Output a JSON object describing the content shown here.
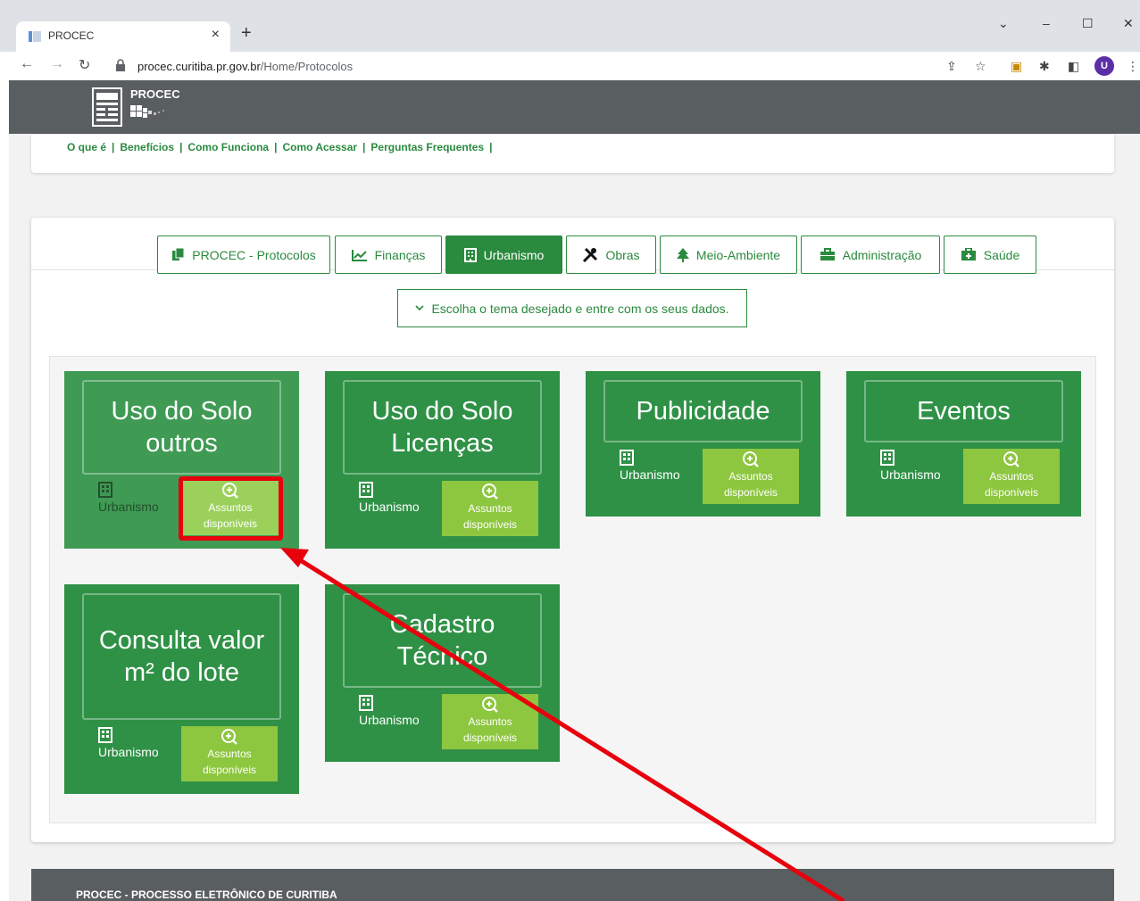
{
  "browser": {
    "tab_title": "PROCEC",
    "tab_close": "×",
    "new_tab": "+",
    "url_host": "procec.curitiba.pr.gov.br",
    "url_path": "/Home/Protocolos",
    "avatar_letter": "U"
  },
  "header": {
    "logo_text": "PROCEC"
  },
  "menu": {
    "links": [
      "O que é",
      "Benefícios",
      "Como Funciona",
      "Como Acessar",
      "Perguntas Frequentes"
    ],
    "separator": "|"
  },
  "category_tabs": [
    {
      "label": "PROCEC - Protocolos",
      "icon": "copy-icon"
    },
    {
      "label": "Finanças",
      "icon": "chart-line-icon"
    },
    {
      "label": "Urbanismo",
      "icon": "building-icon",
      "active": true
    },
    {
      "label": "Obras",
      "icon": "tools-icon"
    },
    {
      "label": "Meio-Ambiente",
      "icon": "tree-icon"
    },
    {
      "label": "Administração",
      "icon": "briefcase-icon"
    },
    {
      "label": "Saúde",
      "icon": "medkit-icon"
    }
  ],
  "theme_select": {
    "label": "Escolha o tema desejado e entre com os seus dados."
  },
  "tiles": [
    {
      "title": "Uso do Solo outros",
      "category": "Urbanismo",
      "button": "Assuntos disponíveis"
    },
    {
      "title": "Uso do Solo Licenças",
      "category": "Urbanismo",
      "button": "Assuntos disponíveis"
    },
    {
      "title": "Publicidade",
      "category": "Urbanismo",
      "button": "Assuntos disponíveis"
    },
    {
      "title": "Eventos",
      "category": "Urbanismo",
      "button": "Assuntos disponíveis"
    },
    {
      "title": "Consulta valor m² do lote",
      "category": "Urbanismo",
      "button": "Assuntos disponíveis"
    },
    {
      "title": "Cadastro Técnico",
      "category": "Urbanismo",
      "button": "Assuntos disponíveis"
    }
  ],
  "footer": {
    "text": "PROCEC - PROCESSO ELETRÔNICO DE CURITIBA"
  },
  "colors": {
    "brand_green": "#2a8a3e",
    "button_lime": "#8dc63f",
    "annotation_red": "#e8000d"
  }
}
